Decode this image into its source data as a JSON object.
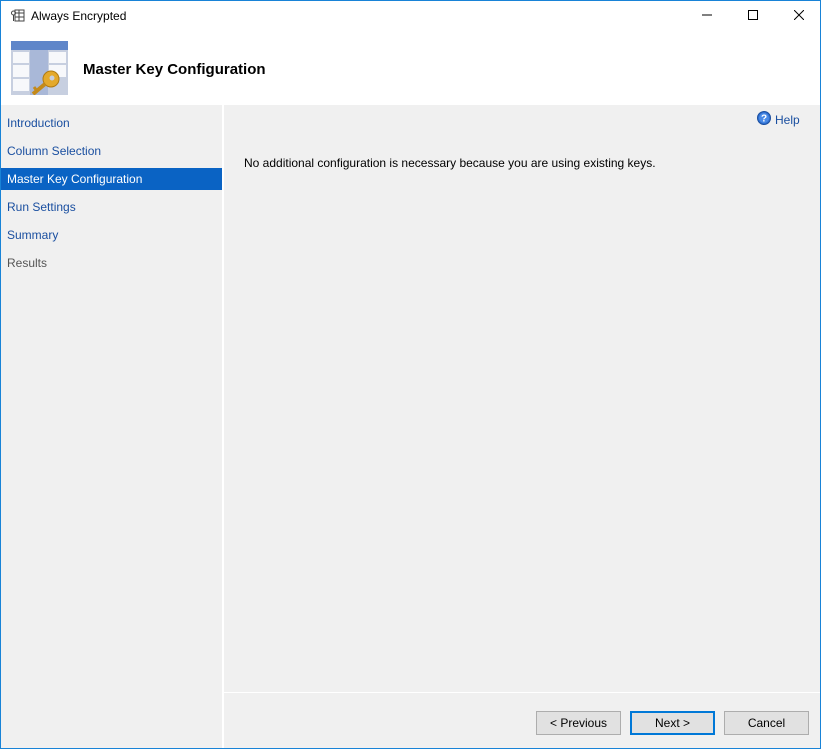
{
  "window": {
    "title": "Always Encrypted",
    "app_icon": "table-key-icon",
    "controls": {
      "minimize": "minimize-icon",
      "maximize": "maximize-icon",
      "close": "close-icon"
    }
  },
  "header": {
    "title": "Master Key Configuration",
    "icon": "table-key-icon"
  },
  "sidebar": {
    "items": [
      {
        "label": "Introduction",
        "state": "link"
      },
      {
        "label": "Column Selection",
        "state": "link"
      },
      {
        "label": "Master Key Configuration",
        "state": "active"
      },
      {
        "label": "Run Settings",
        "state": "link"
      },
      {
        "label": "Summary",
        "state": "link"
      },
      {
        "label": "Results",
        "state": "disabled"
      }
    ]
  },
  "content": {
    "help_label": "Help",
    "message": "No additional configuration is necessary because you are using existing keys."
  },
  "footer": {
    "previous_label": "< Previous",
    "next_label": "Next >",
    "cancel_label": "Cancel"
  },
  "colors": {
    "accent": "#0a63c4",
    "window_border": "#1883d7",
    "link": "#1a4fa0",
    "panel_bg": "#f0f0f0"
  }
}
